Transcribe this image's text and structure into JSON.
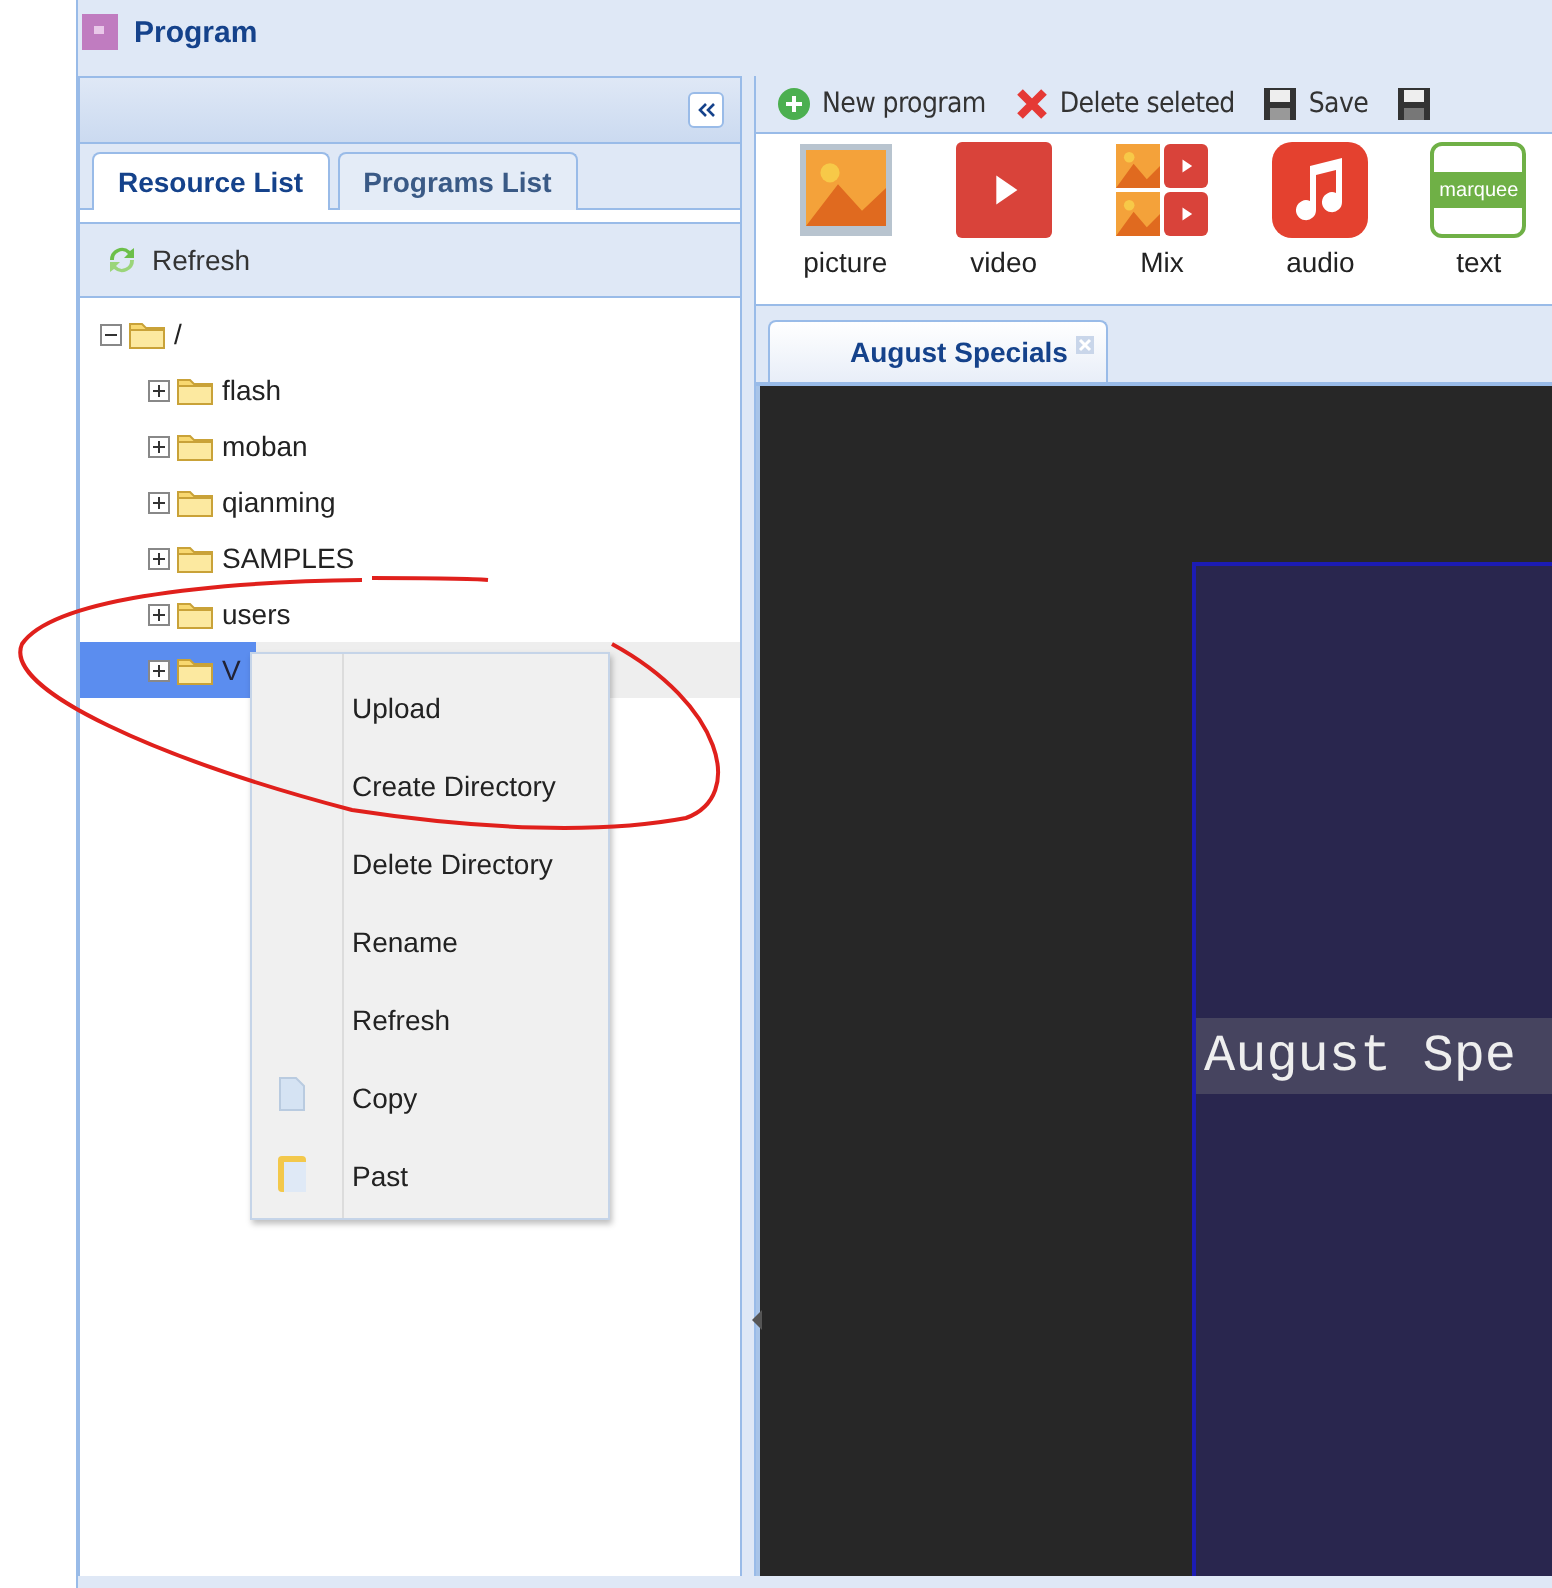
{
  "window": {
    "title": "Program"
  },
  "left_panel": {
    "tabs": [
      {
        "label": "Resource List",
        "selected": true
      },
      {
        "label": "Programs List",
        "selected": false
      }
    ],
    "toolbar": {
      "refresh": "Refresh"
    },
    "tree": {
      "label": "/",
      "expanded": true,
      "selected": false,
      "children": [
        {
          "label": "flash",
          "expanded": false,
          "selected": false
        },
        {
          "label": "moban",
          "expanded": false,
          "selected": false
        },
        {
          "label": "qianming",
          "expanded": false,
          "selected": false
        },
        {
          "label": "SAMPLES",
          "expanded": false,
          "selected": false
        },
        {
          "label": "users",
          "expanded": false,
          "selected": false
        },
        {
          "label": "V",
          "expanded": false,
          "selected": true
        }
      ]
    }
  },
  "context_menu": {
    "items": [
      {
        "label": "Upload",
        "kind": "plain"
      },
      {
        "label": "Create Directory",
        "kind": "plain"
      },
      {
        "label": "Delete Directory",
        "kind": "plain"
      },
      {
        "label": "Rename",
        "kind": "plain"
      },
      {
        "label": "Refresh",
        "kind": "plain"
      },
      {
        "label": "Copy",
        "kind": "copy"
      },
      {
        "label": "Past",
        "kind": "paste"
      }
    ]
  },
  "toolbar": [
    {
      "label": "New program",
      "kind": "new"
    },
    {
      "label": "Delete seleted",
      "kind": "delete"
    },
    {
      "label": "Save",
      "kind": "save"
    },
    {
      "kind": "save-as"
    }
  ],
  "media": [
    {
      "label": "picture",
      "kind": "picture"
    },
    {
      "label": "video",
      "kind": "video"
    },
    {
      "label": "Mix",
      "kind": "mix"
    },
    {
      "label": "audio",
      "kind": "audio"
    },
    {
      "label": "text",
      "kind": "text",
      "icon_text": "marquee"
    }
  ],
  "editor_tabs": [
    {
      "label": "August Specials",
      "selected": true
    }
  ],
  "canvas": {
    "text": "August Spe"
  }
}
